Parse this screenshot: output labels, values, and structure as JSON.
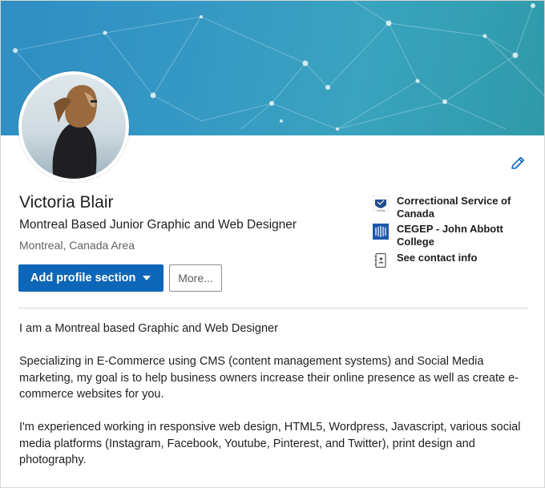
{
  "profile": {
    "name": "Victoria Blair",
    "headline": "Montreal Based Junior Graphic and Web Designer",
    "location": "Montreal, Canada Area"
  },
  "actions": {
    "add_profile_section_label": "Add profile section",
    "more_label": "More..."
  },
  "sidebar": {
    "items": [
      {
        "label": "Correctional Service of Canada",
        "icon": "csc-logo-icon"
      },
      {
        "label": "CEGEP - John Abbott College",
        "icon": "college-logo-icon"
      },
      {
        "label": "See contact info",
        "icon": "contact-card-icon"
      }
    ]
  },
  "about": {
    "paragraphs": [
      "I am a Montreal based Graphic and Web Designer",
      "Specializing in E-Commerce using CMS (content management systems) and Social Media marketing, my goal is to help business owners increase their online presence as well as create e-commerce websites for you.",
      "I'm experienced working in responsive web design, HTML5, Wordpress, Javascript, various social media platforms (Instagram, Facebook, Youtube, Pinterest, and Twitter), print design and photography."
    ]
  },
  "colors": {
    "primary_button": "#0d66b7",
    "banner": "#3598c4",
    "edit_icon": "#0d66b7"
  }
}
